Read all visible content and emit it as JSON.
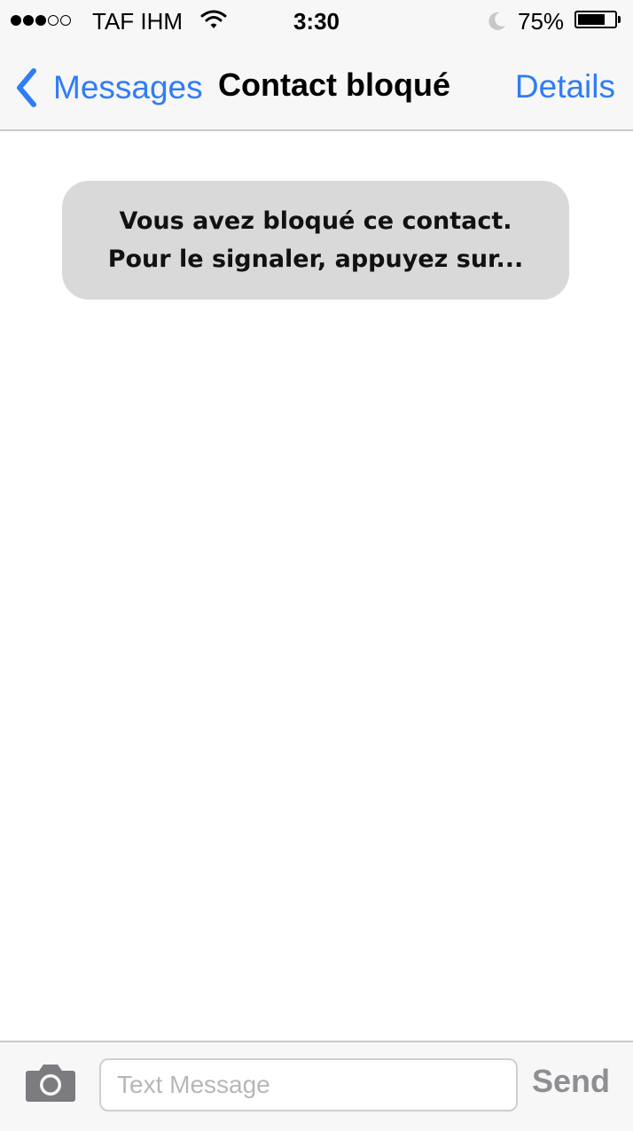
{
  "status_bar": {
    "signal_bars": 3,
    "signal_total": 5,
    "carrier": "TAF IHM",
    "wifi_icon": "wifi-icon",
    "time": "3:30",
    "dnd_icon": "moon-icon",
    "battery_percent": "75%",
    "battery_level": 0.75
  },
  "nav": {
    "back_label": "Messages",
    "title": "Contact bloqué",
    "details_label": "Details"
  },
  "conversation": {
    "message_text": "Vous avez bloqué ce contact. Pour le signaler, appuyez sur..."
  },
  "compose": {
    "camera_icon": "camera-icon",
    "placeholder": "Text Message",
    "value": "",
    "send_label": "Send"
  },
  "colors": {
    "accent": "#2f7df6",
    "bubble": "#d9d9d9",
    "bar_background": "#f7f7f7",
    "send_disabled": "#8e8e93"
  }
}
